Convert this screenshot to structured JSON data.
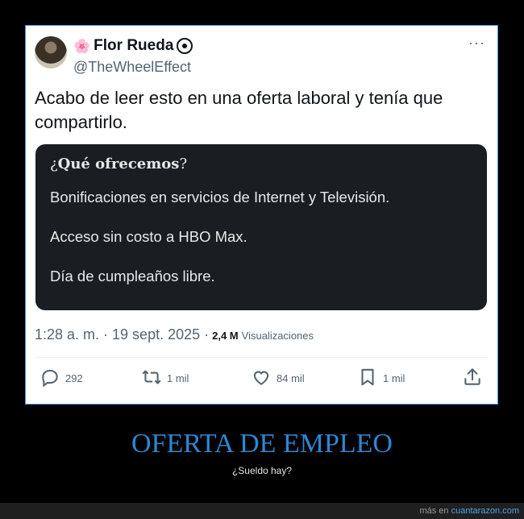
{
  "tweet": {
    "name_emoji": "🌸",
    "display_name": "Flor Rueda",
    "handle": "@TheWheelEffect",
    "more_icon": "···",
    "text": "Acabo de leer esto en una oferta laboral y tenía que compartirlo.",
    "card": {
      "title_prefix": "¿",
      "title_bold": "Qué ofrecemos",
      "title_suffix": "?",
      "lines": [
        "Bonificaciones en servicios de Internet y Televisión.",
        "Acceso sin costo a HBO Max.",
        "Día de cumpleaños libre."
      ]
    },
    "time": "1:28 a. m. · 19 sept. 2025 ·",
    "views_count": "2,4 M",
    "views_label": "Visualizaciones",
    "actions": {
      "reply_count": "292",
      "retweet_count": "1 mil",
      "like_count": "84 mil",
      "bookmark_count": "1 mil"
    }
  },
  "caption": {
    "headline": "OFERTA DE EMPLEO",
    "subtitle": "¿Sueldo hay?"
  },
  "footer": {
    "prefix": "más en",
    "link": "cuantarazon.com"
  },
  "colors": {
    "accent": "#2d87d2",
    "card_bg": "#1a1e22",
    "muted": "#536471"
  }
}
